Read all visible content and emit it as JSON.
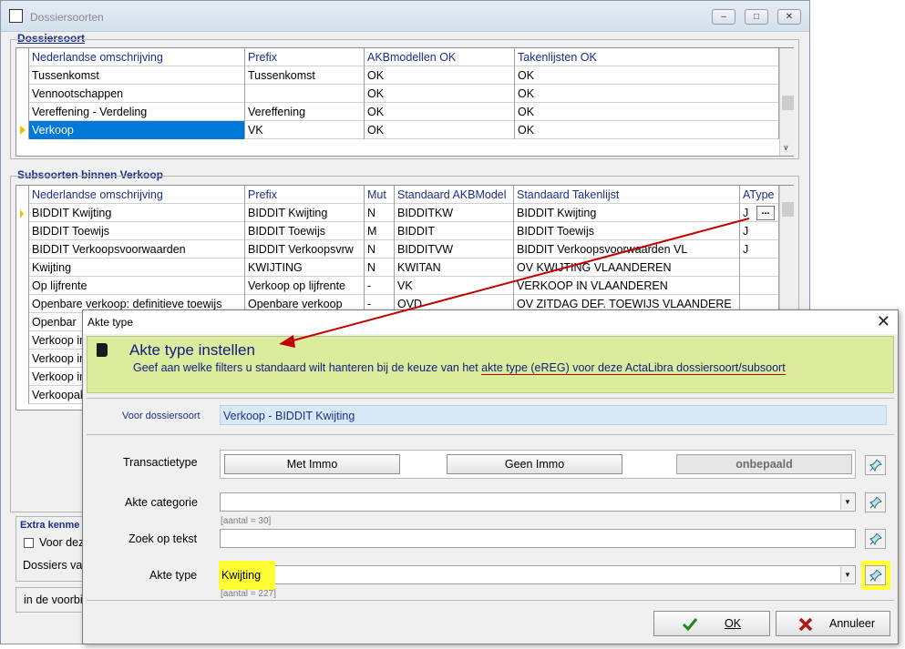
{
  "window": {
    "title": "Dossiersoorten"
  },
  "dossiersoort": {
    "group_title": "Dossiersoort",
    "columns": [
      "Nederlandse omschrijving",
      "Prefix",
      "AKBmodellen OK",
      "Takenlijsten OK"
    ],
    "rows": [
      [
        "Tussenkomst",
        "Tussenkomst",
        "OK",
        "OK"
      ],
      [
        "Vennootschappen",
        "",
        "OK",
        "OK"
      ],
      [
        "Vereffening - Verdeling",
        "Vereffening",
        "OK",
        "OK"
      ],
      [
        "Verkoop",
        "VK",
        "OK",
        "OK"
      ]
    ]
  },
  "subsoorten": {
    "group_title": "Subsoorten binnen Verkoop",
    "columns": [
      "Nederlandse omschrijving",
      "Prefix",
      "Mut",
      "Standaard AKBModel",
      "Standaard Takenlijst",
      "AType"
    ],
    "rows": [
      [
        "BIDDIT Kwijting",
        "BIDDIT Kwijting",
        "N",
        "BIDDITKW",
        "BIDDIT Kwijting",
        "J"
      ],
      [
        "BIDDIT Toewijs",
        "BIDDIT Toewijs",
        "M",
        "BIDDIT",
        "BIDDIT Toewijs",
        "J"
      ],
      [
        "BIDDIT Verkoopsvoorwaarden",
        "BIDDIT Verkoopsvrw",
        "N",
        "BIDDITVW",
        "BIDDIT Verkoopsvoorwaarden VL",
        "J"
      ],
      [
        "Kwijting",
        "KWIJTING",
        "N",
        "KWITAN",
        "OV KWIJTING VLAANDEREN",
        ""
      ],
      [
        "Op lijfrente",
        "Verkoop op lijfrente",
        "-",
        "VK",
        "VERKOOP IN VLAANDEREN",
        ""
      ],
      [
        "Openbare verkoop: definitieve toewijs",
        "Openbare verkoop",
        "-",
        "OVD",
        "OV ZITDAG DEF. TOEWIJS VLAANDERE",
        ""
      ],
      [
        "Openbar",
        "",
        "",
        "",
        "",
        ""
      ],
      [
        "Verkoop in",
        "",
        "",
        "",
        "",
        ""
      ],
      [
        "Verkoop in",
        "",
        "",
        "",
        "",
        ""
      ],
      [
        "Verkoop in",
        "",
        "",
        "",
        "",
        ""
      ],
      [
        "Verkoopak",
        "",
        "",
        "",
        "",
        ""
      ]
    ],
    "ellipsis": "..."
  },
  "extra": {
    "title": "Extra kenme",
    "checkbox_label": "Voor deze",
    "dossiers_label": "Dossiers va",
    "bottom_label": "in de voorbij"
  },
  "dialog": {
    "title": "Akte type",
    "heading": "Akte type instellen",
    "description_pre": "Geef aan welke filters u standaard wilt hanteren bij de keuze van het ",
    "description_link": "akte type (eREG) voor deze ActaLibra dossiersoort/subsoort",
    "voor_label": "Voor dossiersoort",
    "voor_value": "Verkoop - BIDDIT Kwijting",
    "transactietype_label": "Transactietype",
    "btn_met_immo": "Met Immo",
    "btn_geen_immo": "Geen Immo",
    "btn_onbepaald": "onbepaald",
    "akte_categorie_label": "Akte categorie",
    "akte_categorie_value": "",
    "akte_categorie_count": "[aantal = 30]",
    "zoek_label": "Zoek op tekst",
    "zoek_value": "",
    "akte_type_label": "Akte type",
    "akte_type_value": "Kwijting",
    "akte_type_count": "[aantal = 227]",
    "ok_label": "OK",
    "cancel_label": "Annuleer"
  },
  "colors": {
    "accent_blue": "#0078d7",
    "banner": "#dbec9c",
    "highlight": "#ffff33",
    "arrow": "#c00000",
    "title_text": "#101a80"
  }
}
